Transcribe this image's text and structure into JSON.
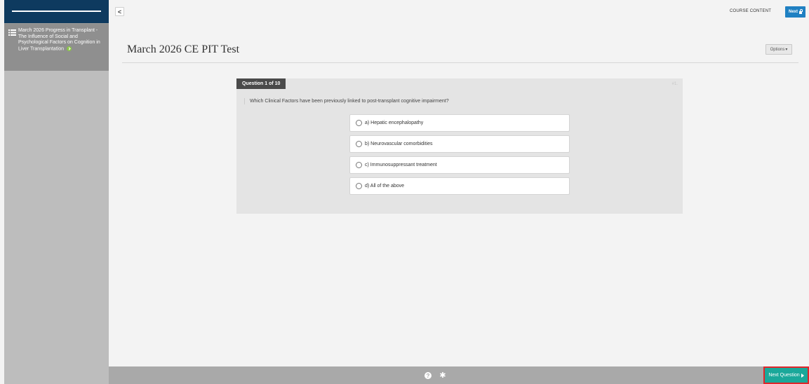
{
  "sidebar": {
    "module_title": "March 2026 Progress in Transplant - The Influence of Social and Psychological Factors on Cognition in Liver Transplantation"
  },
  "topbar": {
    "collapse_label": "<",
    "course_content_label": "COURSE CONTENT",
    "next_label": "Next"
  },
  "page": {
    "title": "March 2026 CE PIT Test",
    "options_label": "Options"
  },
  "question": {
    "badge": "Question 1 of 10",
    "number": "#1.",
    "text": "Which Clinical Factors have been previously linked to post-transplant cognitive impairment?",
    "answers": [
      "a) Hepatic encephalopathy",
      "b) Neurovascular comorbidities",
      "c) Immunosuppressant treatment",
      "d) All of the above"
    ]
  },
  "footer": {
    "help_glyph": "?",
    "next_question_label": "Next Question"
  },
  "colors": {
    "sidebar_header": "#0e3a5f",
    "next_button": "#1f80c2",
    "next_question": "#1aa89a",
    "highlight": "#e0262a"
  }
}
